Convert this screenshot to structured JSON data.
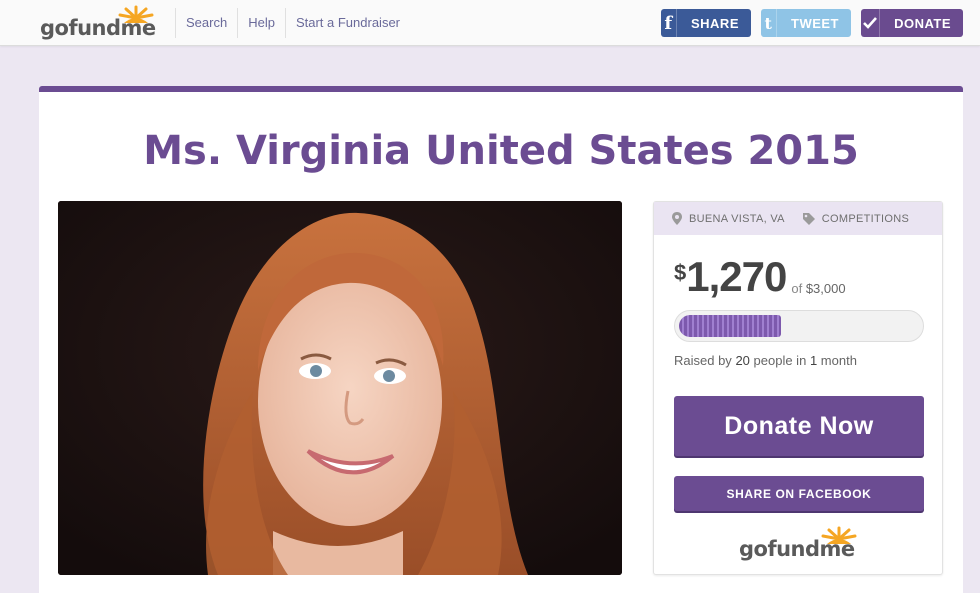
{
  "header": {
    "logo": {
      "go": "go",
      "fund": "fund",
      "me": "me"
    },
    "nav": [
      "Search",
      "Help",
      "Start a Fundraiser"
    ],
    "buttons": {
      "share": {
        "icon": "facebook-icon",
        "label": "SHARE"
      },
      "tweet": {
        "icon": "twitter-icon",
        "label": "TWEET"
      },
      "donate": {
        "icon": "checkmark-icon",
        "label": "DONATE"
      }
    }
  },
  "campaign": {
    "title": "Ms. Virginia United States 2015",
    "location": "BUENA VISTA, VA",
    "category": "COMPETITIONS",
    "raised": {
      "currency": "$",
      "amount": "1,270",
      "of_label": "of",
      "goal": "$3,000"
    },
    "progress_fraction": 0.4233,
    "raised_by": {
      "prefix": "Raised by",
      "people": "20",
      "people_label": "people in",
      "time": "1",
      "time_label": "month"
    },
    "donate_now": "Donate Now",
    "share_facebook": "SHARE ON FACEBOOK"
  },
  "colors": {
    "brand_purple": "#6b4c92",
    "facebook_blue": "#3b5a98",
    "twitter_blue": "#8fc4e6",
    "sun_orange": "#f5a623"
  }
}
